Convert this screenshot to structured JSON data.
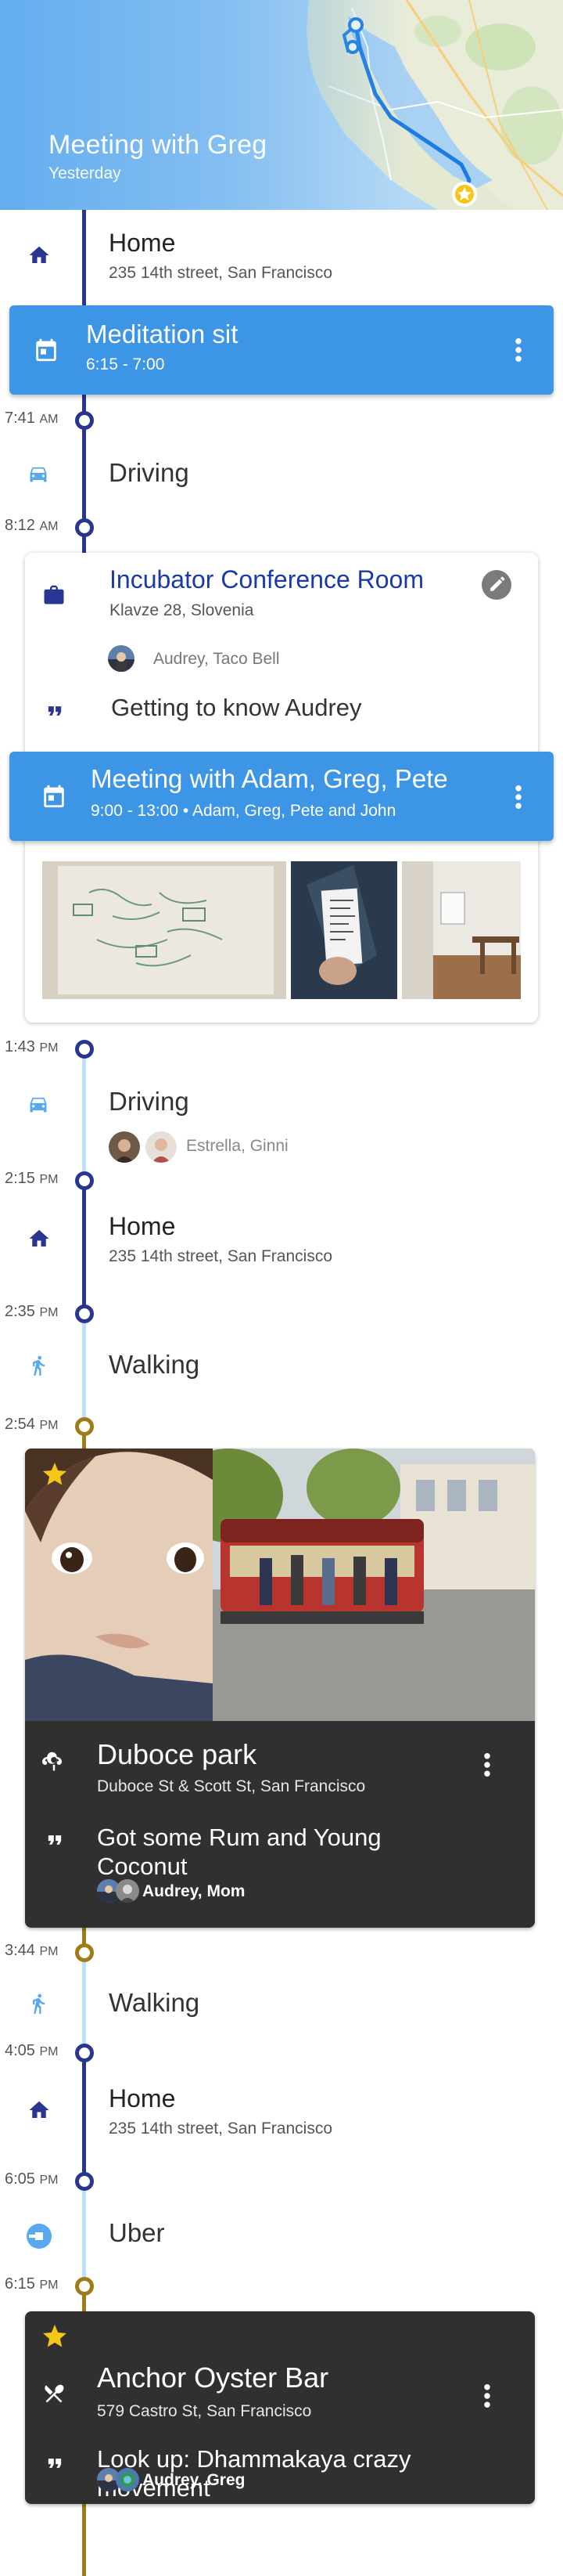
{
  "header": {
    "title": "Meeting with Greg",
    "subtitle": "Yesterday"
  },
  "times": [
    {
      "hm": "7:41",
      "ap": "AM"
    },
    {
      "hm": "8:12",
      "ap": "AM"
    },
    {
      "hm": "1:43",
      "ap": "PM"
    },
    {
      "hm": "2:15",
      "ap": "PM"
    },
    {
      "hm": "2:35",
      "ap": "PM"
    },
    {
      "hm": "2:54",
      "ap": "PM"
    },
    {
      "hm": "3:44",
      "ap": "PM"
    },
    {
      "hm": "4:05",
      "ap": "PM"
    },
    {
      "hm": "6:05",
      "ap": "PM"
    },
    {
      "hm": "6:15",
      "ap": "PM"
    }
  ],
  "home": {
    "title": "Home",
    "address": "235 14th street, San Francisco"
  },
  "meditation": {
    "title": "Meditation sit",
    "time": "6:15 - 7:00"
  },
  "driving_1": {
    "label": "Driving"
  },
  "incubator": {
    "title": "Incubator Conference Room",
    "address": "Klavze 28, Slovenia",
    "people": "Audrey, Taco Bell",
    "note": "Getting to know Audrey"
  },
  "meeting": {
    "title": "Meeting with Adam, Greg, Pete",
    "detail": "9:00 - 13:00 • Adam, Greg, Pete and John"
  },
  "driving_2": {
    "label": "Driving",
    "people": "Estrella, Ginni"
  },
  "walking_1": {
    "label": "Walking"
  },
  "duboce": {
    "title": "Duboce park",
    "address": "Duboce St & Scott St, San Francisco",
    "note": "Got some Rum and Young Coconut",
    "people": "Audrey, Mom"
  },
  "walking_2": {
    "label": "Walking"
  },
  "uber": {
    "label": "Uber"
  },
  "anchor": {
    "title": "Anchor Oyster Bar",
    "address": "579 Castro St, San Francisco",
    "note": "Look up: Dhammakaya crazy movement",
    "people": "Audrey, Greg"
  },
  "colors": {
    "primary_blue": "#3d95e6",
    "timeline_navy": "#283593",
    "timeline_light": "#bfe0fb",
    "timeline_gold": "#a07c18",
    "title_blue": "#1a3aa8",
    "dark_card": "#303030",
    "star": "#f5c518"
  },
  "icons": [
    "home-icon",
    "calendar-icon",
    "car-icon",
    "briefcase-icon",
    "quote-icon",
    "walk-icon",
    "park-icon",
    "restaurant-icon",
    "uber-icon",
    "star-icon",
    "more-vert-icon",
    "edit-icon"
  ]
}
